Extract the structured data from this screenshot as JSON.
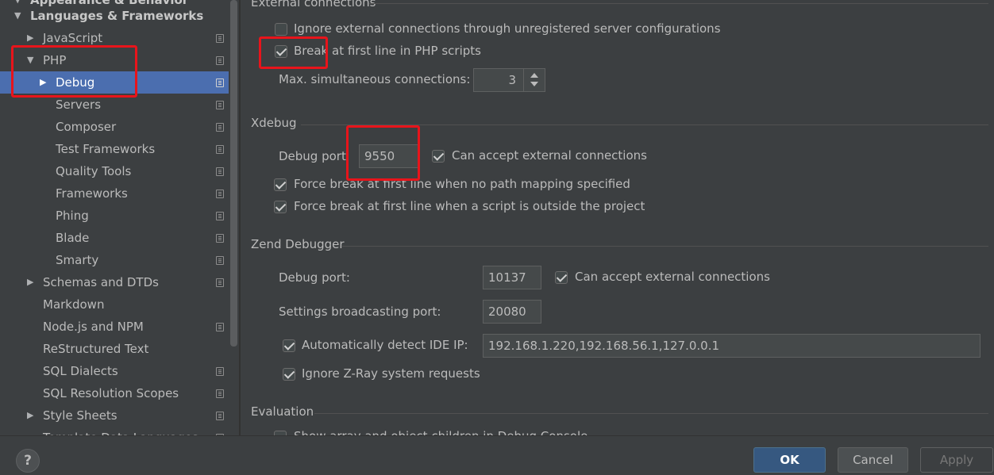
{
  "sidebar": {
    "cut_top": "Appearance & Behavior",
    "group": "Languages & Frameworks",
    "items": [
      {
        "label": "JavaScript",
        "arrow": "▶",
        "settings_icon": true
      },
      {
        "label": "PHP",
        "arrow": "▼",
        "settings_icon": true
      },
      {
        "label": "Debug",
        "arrow": "▶",
        "settings_icon": true,
        "selected": true
      },
      {
        "label": "Servers",
        "settings_icon": true
      },
      {
        "label": "Composer",
        "settings_icon": true
      },
      {
        "label": "Test Frameworks",
        "settings_icon": true
      },
      {
        "label": "Quality Tools",
        "settings_icon": true
      },
      {
        "label": "Frameworks",
        "settings_icon": true
      },
      {
        "label": "Phing",
        "settings_icon": true
      },
      {
        "label": "Blade",
        "settings_icon": true
      },
      {
        "label": "Smarty",
        "settings_icon": true
      },
      {
        "label": "Schemas and DTDs",
        "arrow": "▶",
        "settings_icon": true
      },
      {
        "label": "Markdown",
        "settings_icon": false
      },
      {
        "label": "Node.js and NPM",
        "settings_icon": true
      },
      {
        "label": "ReStructured Text",
        "settings_icon": false
      },
      {
        "label": "SQL Dialects",
        "settings_icon": true
      },
      {
        "label": "SQL Resolution Scopes",
        "settings_icon": true
      },
      {
        "label": "Style Sheets",
        "arrow": "▶",
        "settings_icon": true
      },
      {
        "label": "Template Data Languages",
        "arrow": "",
        "settings_icon": true
      }
    ]
  },
  "external": {
    "title": "External connections",
    "ignore_label": "Ignore external connections through unregistered server configurations",
    "ignore_checked": false,
    "break_label": "Break at first line in PHP scripts",
    "break_checked": true,
    "max_label": "Max. simultaneous connections:",
    "max_value": "3"
  },
  "xdebug": {
    "title": "Xdebug",
    "port_label": "Debug port",
    "port_value": "9550",
    "accept_label": "Can accept external connections",
    "accept_checked": true,
    "force1_label": "Force break at first line when no path mapping specified",
    "force1_checked": true,
    "force2_label": "Force break at first line when a script is outside the project",
    "force2_checked": true
  },
  "zend": {
    "title": "Zend Debugger",
    "port_label": "Debug port:",
    "port_value": "10137",
    "accept_label": "Can accept external connections",
    "accept_checked": true,
    "broadcast_label": "Settings broadcasting port:",
    "broadcast_value": "20080",
    "detect_label": "Automatically detect IDE IP:",
    "detect_checked": true,
    "detect_value": "192.168.1.220,192.168.56.1,127.0.0.1",
    "ignore_zray_label": "Ignore Z-Ray system requests",
    "ignore_zray_checked": true
  },
  "evaluation": {
    "title": "Evaluation",
    "cut_label": "Show array and object children in Debug Console",
    "cut_checked": false
  },
  "buttons": {
    "help": "?",
    "ok": "OK",
    "cancel": "Cancel",
    "apply": "Apply"
  },
  "colors": {
    "background": "#3c3f41",
    "selection": "#4b6eaf",
    "highlight_box": "#e8141b",
    "ok_button": "#365880"
  }
}
